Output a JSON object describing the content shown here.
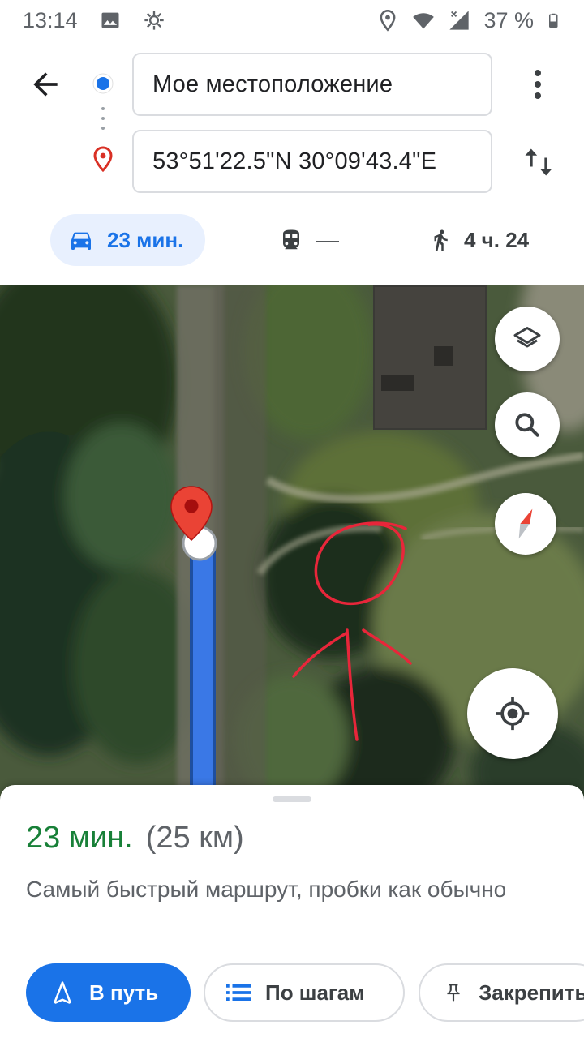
{
  "status_bar": {
    "time": "13:14",
    "battery": "37 %",
    "icons": [
      "image-icon",
      "settings-sun-icon",
      "location-icon",
      "wifi-icon",
      "signal-icon",
      "battery-icon"
    ]
  },
  "directions": {
    "from": "Мое местоположение",
    "to": "53°51'22.5\"N 30°09'43.4\"E",
    "modes": [
      {
        "name": "driving",
        "icon": "car-icon",
        "label": "23 мин.",
        "selected": true
      },
      {
        "name": "transit",
        "icon": "train-icon",
        "label": "—",
        "selected": false
      },
      {
        "name": "walking",
        "icon": "walking-icon",
        "label": "4 ч. 24",
        "selected": false
      }
    ]
  },
  "map": {
    "controls": [
      "layers-icon",
      "search-icon",
      "compass-icon",
      "my-location-icon"
    ],
    "route_color": "#3a78e6",
    "pin_color": "#ea4335",
    "annotation_color": "#e8263a"
  },
  "route_summary": {
    "time": "23 мин.",
    "distance": "(25 км)",
    "description": "Самый быстрый маршрут, пробки как обычно"
  },
  "actions": {
    "start": "В путь",
    "steps": "По шагам",
    "pin": "Закрепить"
  },
  "colors": {
    "accent": "#1a73e8",
    "time_green": "#188038",
    "selected_mode_bg": "#e8f0fe"
  }
}
